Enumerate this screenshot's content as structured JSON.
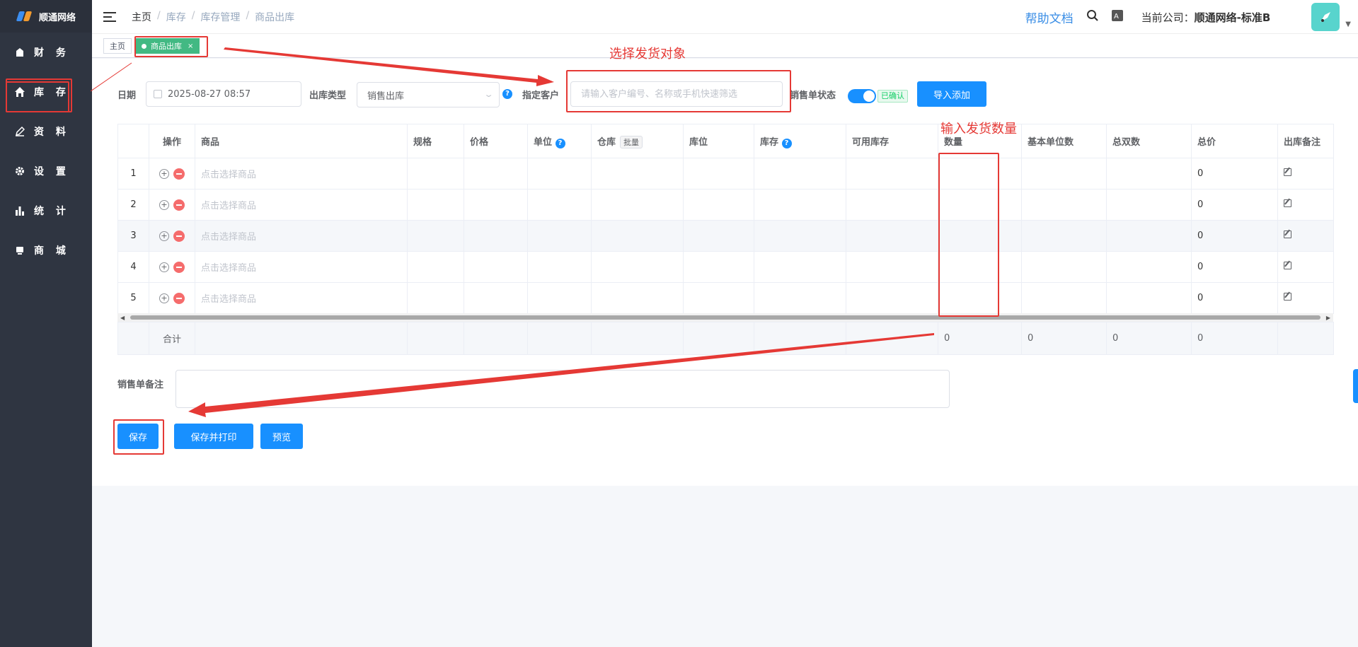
{
  "app": {
    "logo_text": "顺通网络"
  },
  "sidebar": {
    "items": [
      {
        "label": "财 务",
        "icon": "wallet-icon"
      },
      {
        "label": "库 存",
        "icon": "home-icon",
        "active": true
      },
      {
        "label": "资 料",
        "icon": "edit-icon"
      },
      {
        "label": "设 置",
        "icon": "gear-icon"
      },
      {
        "label": "统 计",
        "icon": "bar-chart-icon"
      },
      {
        "label": "商 城",
        "icon": "store-icon"
      }
    ]
  },
  "header": {
    "breadcrumb": [
      "主页",
      "库存",
      "库存管理",
      "商品出库"
    ],
    "breadcrumb_sep": "/",
    "help_label": "帮助文档",
    "company_prefix": "当前公司：",
    "company_name": "顺通网络-标准B"
  },
  "tags": {
    "home": "主页",
    "active": "商品出库",
    "close": "×"
  },
  "form": {
    "date_label": "日期",
    "date_value": "2025-08-27 08:57",
    "type_label": "出库类型",
    "type_value": "销售出库",
    "customer_label": "指定客户",
    "customer_placeholder": "请输入客户编号、名称或手机快速筛选",
    "status_label": "销售单状态",
    "status_badge": "已确认",
    "import_button": "导入添加"
  },
  "table": {
    "headers": [
      "",
      "操作",
      "商品",
      "规格",
      "价格",
      "单位",
      "仓库",
      "库位",
      "库存",
      "可用库存",
      "数量",
      "基本单位数",
      "总双数",
      "总价",
      "出库备注"
    ],
    "batch_label": "批量",
    "rows": [
      {
        "idx": "1",
        "product": "点击选择商品",
        "total": "0"
      },
      {
        "idx": "2",
        "product": "点击选择商品",
        "total": "0"
      },
      {
        "idx": "3",
        "product": "点击选择商品",
        "total": "0"
      },
      {
        "idx": "4",
        "product": "点击选择商品",
        "total": "0"
      },
      {
        "idx": "5",
        "product": "点击选择商品",
        "total": "0"
      }
    ],
    "summary_label": "合计",
    "summary": {
      "qty": "0",
      "base": "0",
      "pairs": "0",
      "total": "0"
    }
  },
  "remark_label": "销售单备注",
  "actions": {
    "save": "保存",
    "save_print": "保存并打印",
    "preview": "预览"
  },
  "annotations": {
    "select_target": "选择发货对象",
    "enter_qty": "输入发货数量"
  },
  "colors": {
    "accent": "#1890ff",
    "tag_active": "#42b983",
    "annotation": "#e53935",
    "sidebar": "#2f3541"
  }
}
